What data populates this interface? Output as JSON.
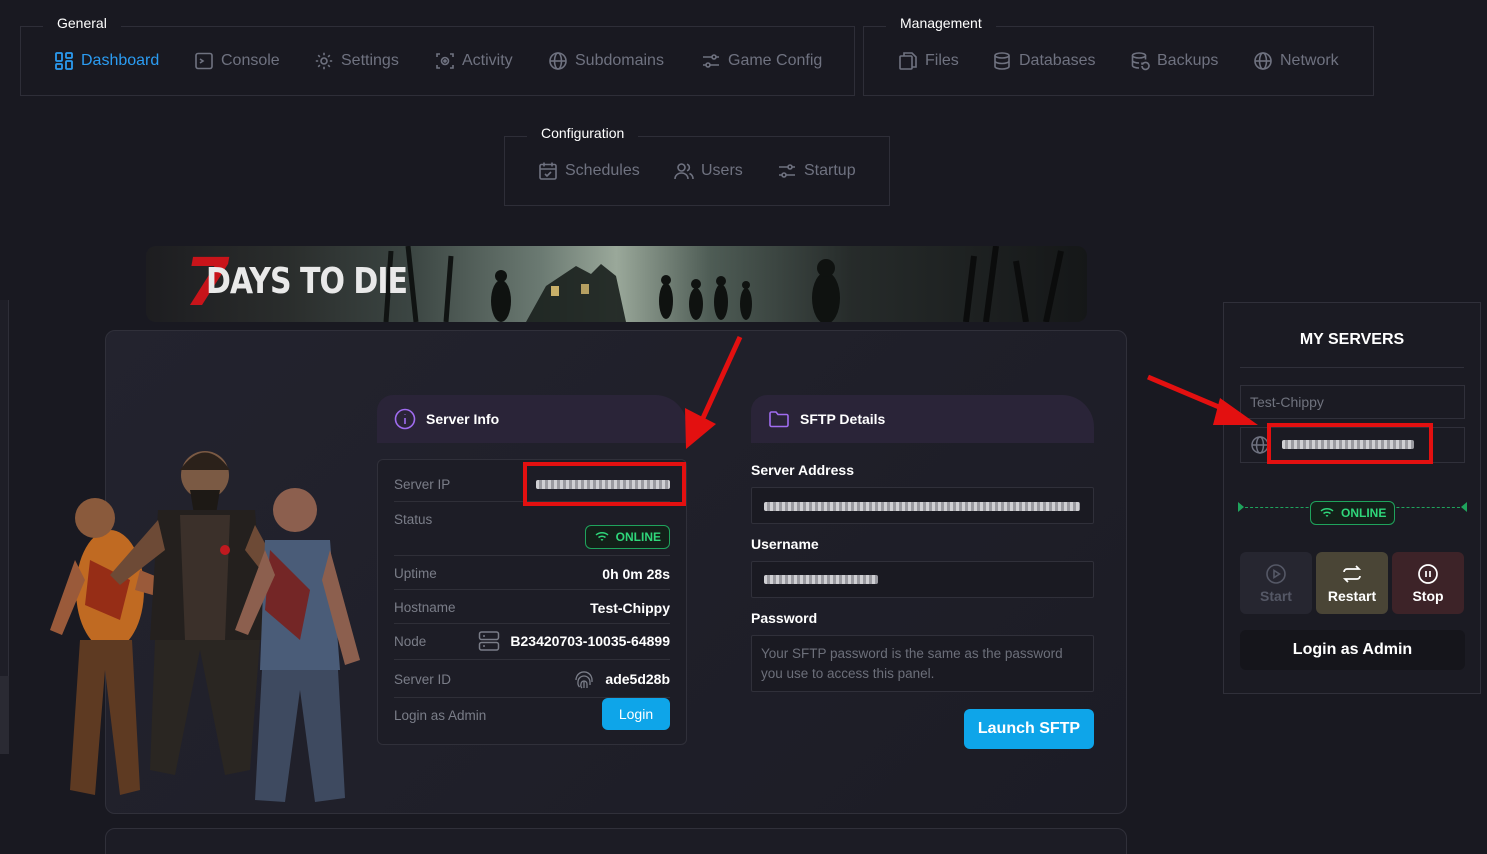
{
  "nav": {
    "general": {
      "title": "General",
      "items": [
        {
          "label": "Dashboard",
          "icon": "dashboard-icon",
          "active": true
        },
        {
          "label": "Console",
          "icon": "terminal-icon"
        },
        {
          "label": "Settings",
          "icon": "gear-icon"
        },
        {
          "label": "Activity",
          "icon": "activity-icon"
        },
        {
          "label": "Subdomains",
          "icon": "globe-icon"
        },
        {
          "label": "Game Config",
          "icon": "sliders-icon"
        }
      ]
    },
    "management": {
      "title": "Management",
      "items": [
        {
          "label": "Files",
          "icon": "files-icon"
        },
        {
          "label": "Databases",
          "icon": "database-icon"
        },
        {
          "label": "Backups",
          "icon": "backup-icon"
        },
        {
          "label": "Network",
          "icon": "globe-icon"
        }
      ]
    },
    "configuration": {
      "title": "Configuration",
      "items": [
        {
          "label": "Schedules",
          "icon": "calendar-icon"
        },
        {
          "label": "Users",
          "icon": "users-icon"
        },
        {
          "label": "Startup",
          "icon": "sliders-icon"
        }
      ]
    }
  },
  "banner": {
    "logo_number": "7",
    "logo_text": "DAYS TO DIE"
  },
  "server_info": {
    "title": "Server Info",
    "rows": {
      "ip_label": "Server IP",
      "status_label": "Status",
      "status_value": "ONLINE",
      "uptime_label": "Uptime",
      "uptime_value": "0h 0m 28s",
      "hostname_label": "Hostname",
      "hostname_value": "Test-Chippy",
      "node_label": "Node",
      "node_value": "B23420703-10035-64899",
      "id_label": "Server ID",
      "id_value": "ade5d28b",
      "admin_label": "Login as Admin",
      "login_button": "Login"
    }
  },
  "sftp": {
    "title": "SFTP Details",
    "address_label": "Server Address",
    "username_label": "Username",
    "password_label": "Password",
    "password_note": "Your SFTP password is the same as the password you use to access this panel.",
    "launch_button": "Launch SFTP"
  },
  "my_servers": {
    "title": "MY SERVERS",
    "server_name": "Test-Chippy",
    "status": "ONLINE",
    "buttons": {
      "start": "Start",
      "restart": "Restart",
      "stop": "Stop"
    },
    "admin_button": "Login as Admin"
  },
  "colors": {
    "background": "#191921",
    "accent": "#0ea5e9",
    "active_nav": "#2b9cf2",
    "online": "#2fd67a",
    "annotation_red": "#e31010"
  }
}
